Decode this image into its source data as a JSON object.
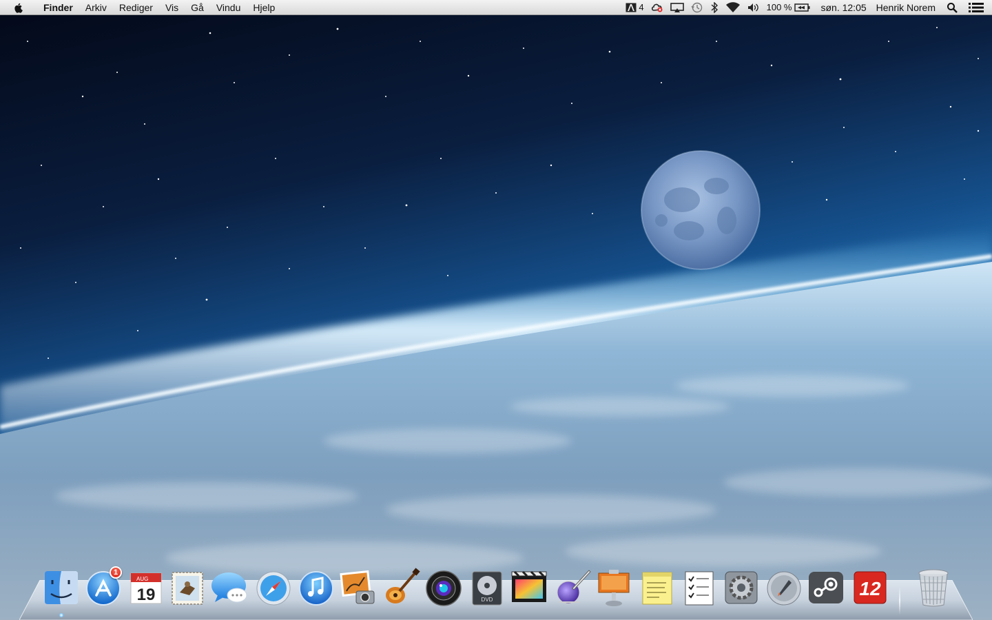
{
  "menubar": {
    "app_name": "Finder",
    "menus": [
      "Arkiv",
      "Rediger",
      "Vis",
      "Gå",
      "Vindu",
      "Hjelp"
    ],
    "adobe_count": "4",
    "battery_percent": "100 %",
    "clock": "søn. 12:05",
    "user_name": "Henrik Norem",
    "status_icons": [
      "adobe-icon",
      "creative-cloud-icon",
      "airplay-icon",
      "time-machine-icon",
      "bluetooth-icon",
      "wifi-icon",
      "volume-icon",
      "battery-icon",
      "spotlight-icon",
      "notification-center-icon"
    ]
  },
  "dock": {
    "apps": [
      {
        "name": "Finder",
        "icon": "finder-icon",
        "running": true
      },
      {
        "name": "App Store",
        "icon": "app-store-icon",
        "badge": "1"
      },
      {
        "name": "Calendar",
        "icon": "calendar-icon",
        "month": "AUG",
        "day": "19"
      },
      {
        "name": "Mail",
        "icon": "mail-icon"
      },
      {
        "name": "Messages",
        "icon": "messages-icon"
      },
      {
        "name": "Safari",
        "icon": "safari-icon"
      },
      {
        "name": "iTunes",
        "icon": "itunes-icon"
      },
      {
        "name": "iPhoto",
        "icon": "iphoto-icon"
      },
      {
        "name": "GarageBand",
        "icon": "garageband-icon"
      },
      {
        "name": "Aperture",
        "icon": "aperture-icon"
      },
      {
        "name": "DVD Player",
        "icon": "dvd-player-icon"
      },
      {
        "name": "Final Cut Pro",
        "icon": "final-cut-pro-icon"
      },
      {
        "name": "Script Editor",
        "icon": "script-editor-icon"
      },
      {
        "name": "Keynote",
        "icon": "keynote-icon"
      },
      {
        "name": "Stickies",
        "icon": "stickies-icon"
      },
      {
        "name": "Reminders",
        "icon": "reminders-icon"
      },
      {
        "name": "System Preferences",
        "icon": "system-preferences-icon"
      },
      {
        "name": "Launchpad",
        "icon": "launchpad-icon"
      },
      {
        "name": "Steam",
        "icon": "steam-icon"
      },
      {
        "name": "Football Manager 2012",
        "icon": "fm12-icon",
        "label": "12"
      }
    ],
    "trash": {
      "name": "Trash",
      "icon": "trash-icon"
    }
  },
  "colors": {
    "space": "#050b1c",
    "atmosphere": "#2f8fd6",
    "horizon_glow": "#eaf6ff",
    "earth": "#7fa6c9",
    "menubar": "#e6e6e6"
  }
}
